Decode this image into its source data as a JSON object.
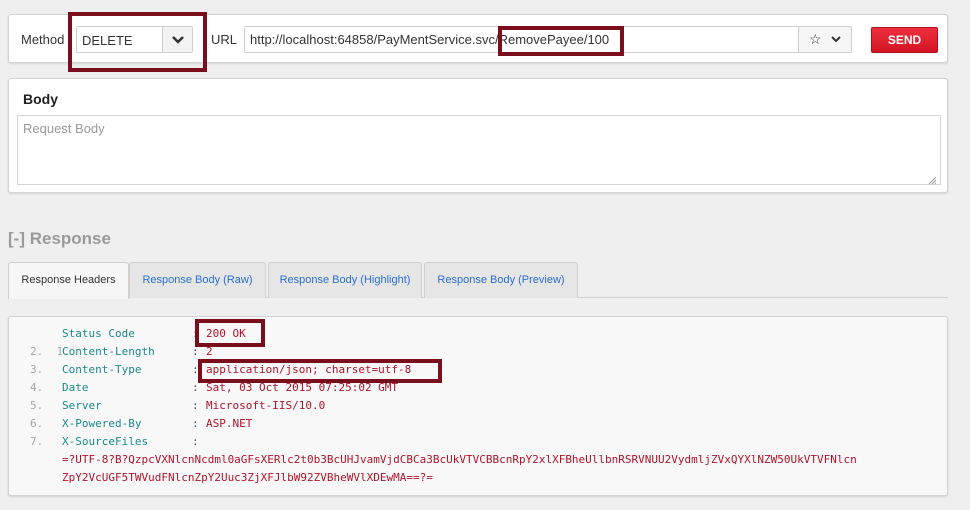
{
  "request": {
    "method_label": "Method",
    "method_value": "DELETE",
    "url_label": "URL",
    "url_value": "http://localhost:64858/PayMentService.svc/RemovePayee/100",
    "send_label": "SEND"
  },
  "body": {
    "title": "Body",
    "placeholder": "Request Body"
  },
  "response": {
    "toggle": "[-]",
    "title": "Response",
    "tabs": [
      {
        "label": "Response Headers",
        "active": true
      },
      {
        "label": "Response Body (Raw)",
        "active": false
      },
      {
        "label": "Response Body (Highlight)",
        "active": false
      },
      {
        "label": "Response Body (Preview)",
        "active": false
      }
    ],
    "headers": [
      {
        "num": "1.",
        "name": "Status Code",
        "value": "200 OK"
      },
      {
        "num": "2.",
        "name": "Content-Length",
        "value": "2"
      },
      {
        "num": "3.",
        "name": "Content-Type",
        "value": "application/json; charset=utf-8"
      },
      {
        "num": "4.",
        "name": "Date",
        "value": "Sat, 03 Oct 2015 07:25:02 GMT"
      },
      {
        "num": "5.",
        "name": "Server",
        "value": "Microsoft-IIS/10.0"
      },
      {
        "num": "6.",
        "name": "X-Powered-By",
        "value": "ASP.NET"
      },
      {
        "num": "7.",
        "name": "X-SourceFiles",
        "value": ""
      }
    ],
    "source_files_value_line1": "=?UTF-8?B?QzpcVXNlcnNcdml0aGFsXERlc2t0b3BcUHJvamVjdCBCa3BcUkVTVCBBcnRpY2xlXFBheUllbnRSRVNUU2VydmljZVxQYXlNZW50UkVTVFNlcn",
    "source_files_value_line2": "ZpY2VcUGF5TWVudFNlcnZpY2Uuc3ZjXFJlbW92ZVBheWVlXDEwMA==?=",
    "separator": ":"
  },
  "colors": {
    "send_button": "#d21423",
    "highlight_box": "#7a0e1c",
    "header_key": "#1a8a8a",
    "header_value": "#b0142a",
    "tab_link": "#2a6fd1"
  },
  "icons": [
    "chevron-down-icon",
    "star-icon",
    "chevron-down-icon",
    "resize-grip-icon"
  ]
}
